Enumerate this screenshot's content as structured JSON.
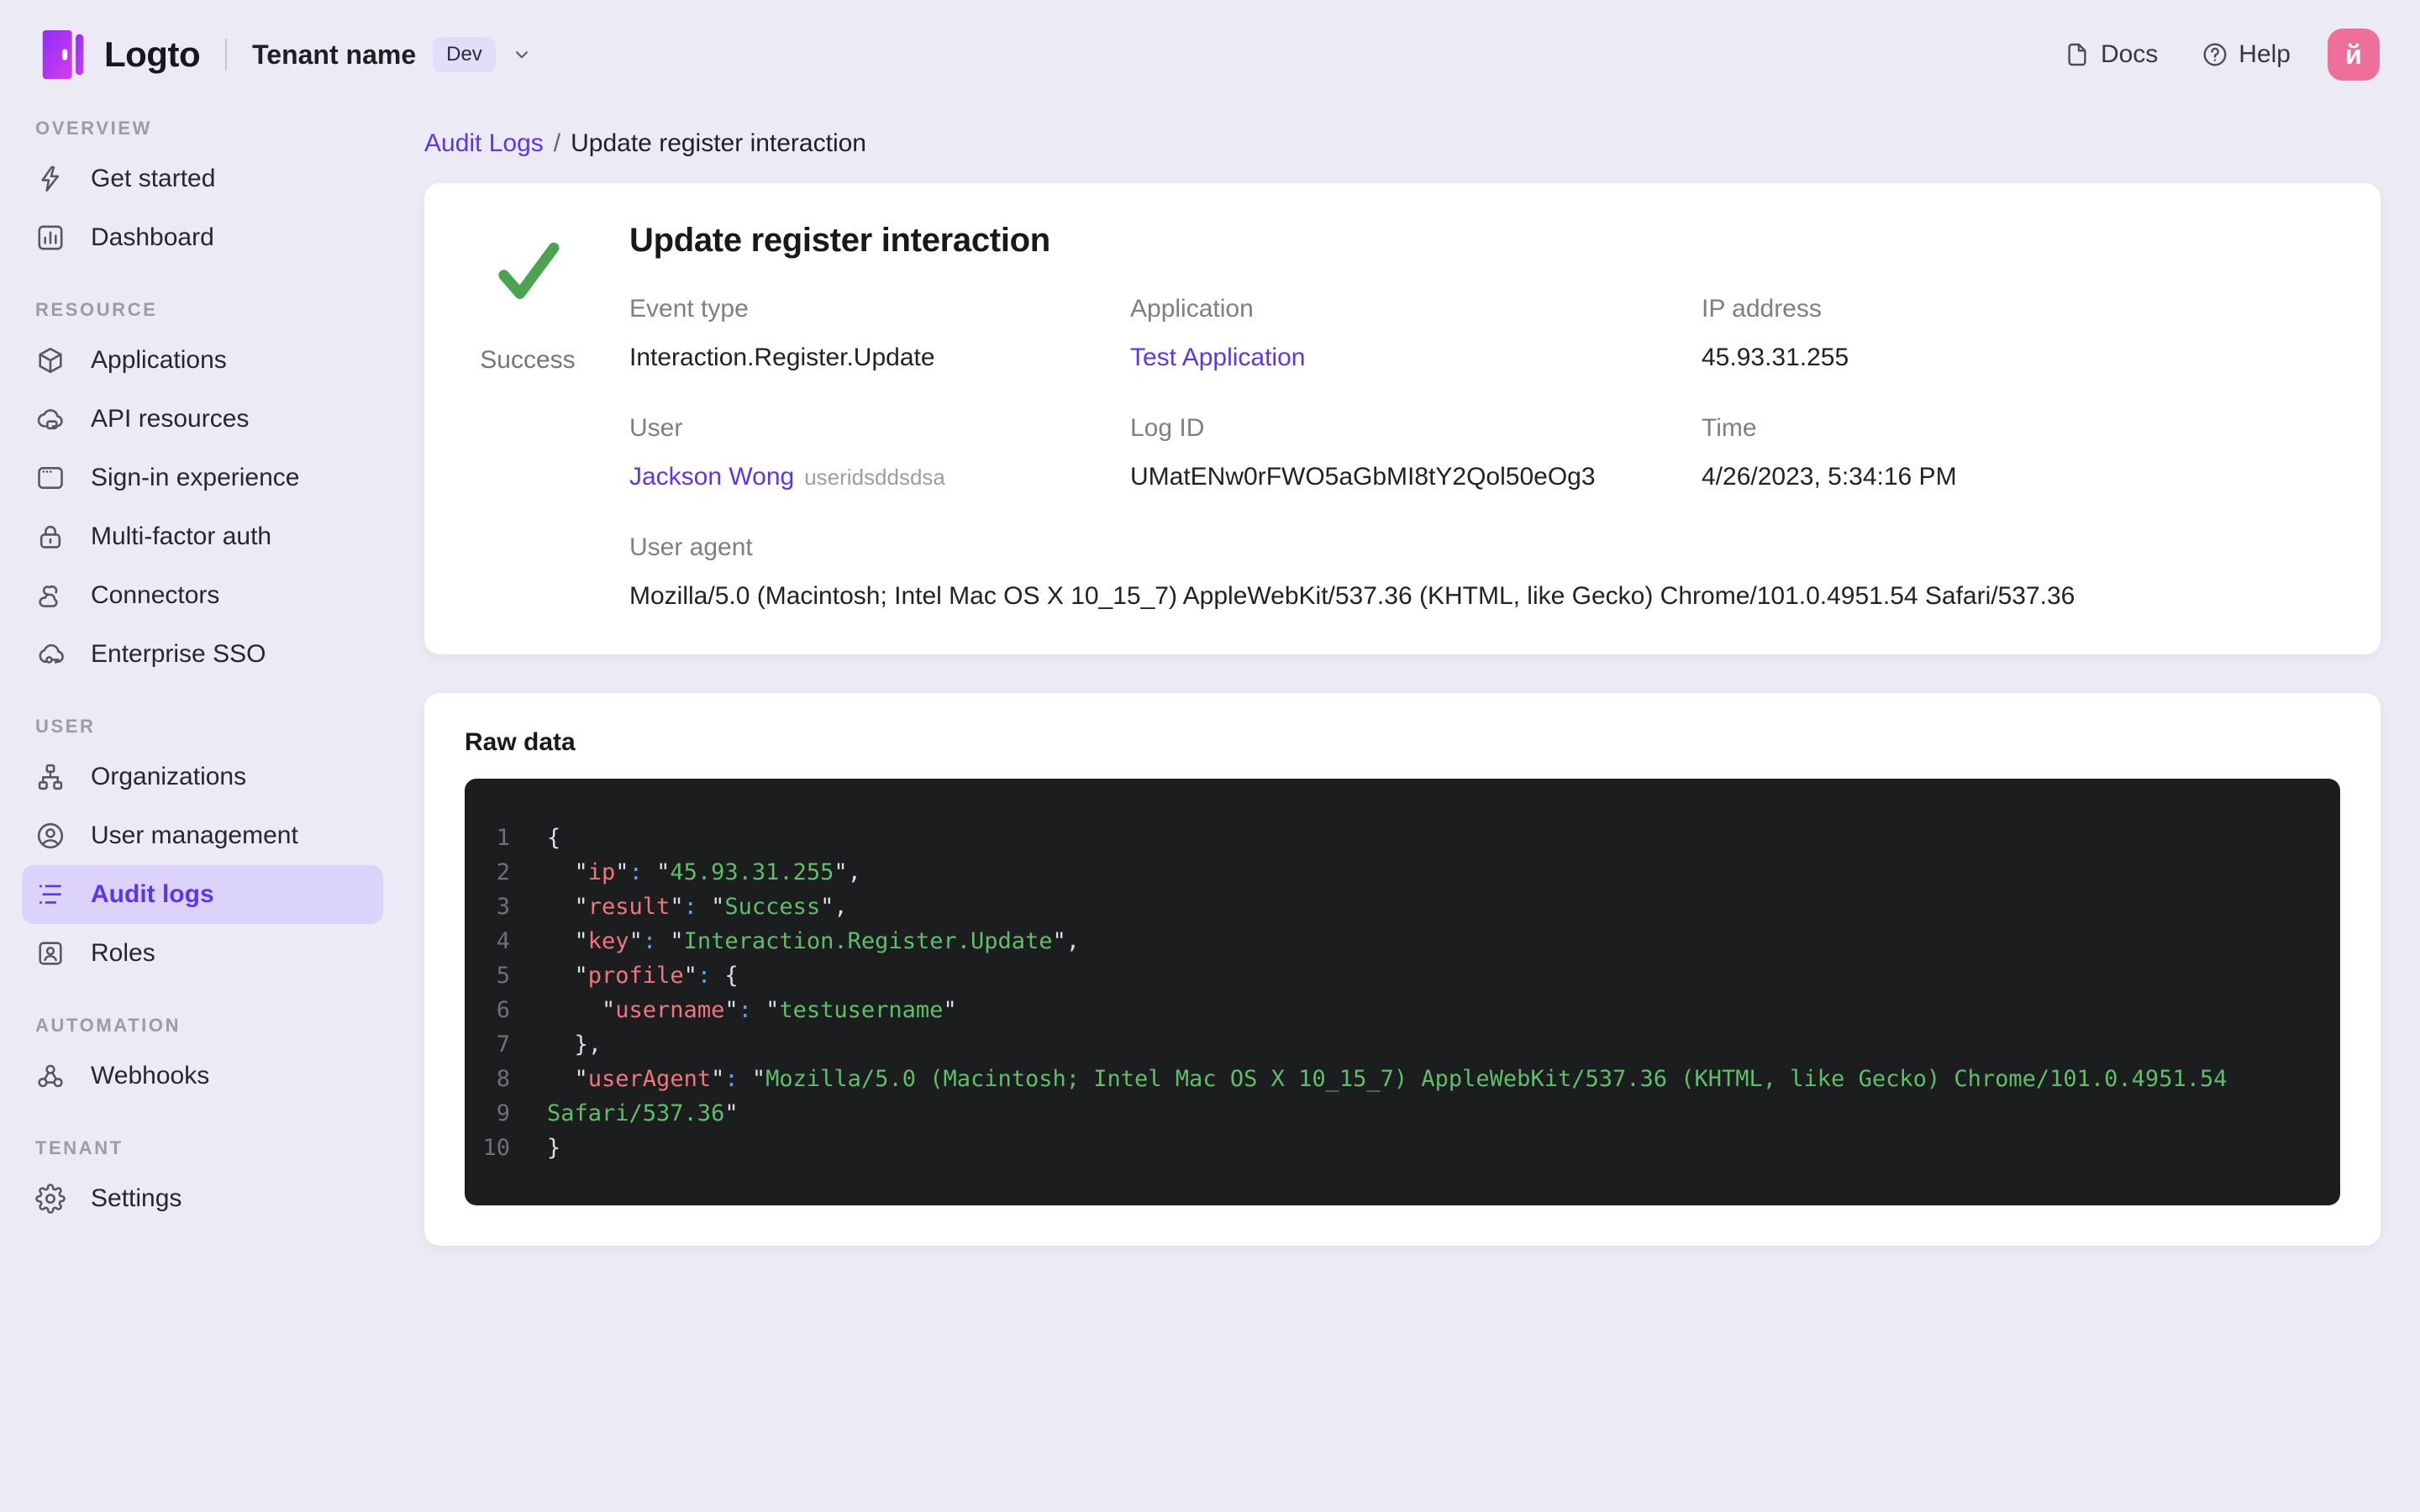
{
  "colors": {
    "accent": "#5d34f2",
    "accent_bg": "#dcd3fa",
    "page_bg": "#eceaf4",
    "card_bg": "#ffffff",
    "badge_bg": "#e3ddf9",
    "avatar_pink": "#ee6f9a",
    "success_green": "#4aa34f",
    "code_bg": "#1c1d1f",
    "code_text": "#dcdfe3",
    "code_line_number": "#6e7278",
    "code_key": "#f0767c",
    "code_colon": "#5ba3f0",
    "code_string": "#5fbf68"
  },
  "topbar": {
    "logo_text": "Logto",
    "tenant_name": "Tenant name",
    "env_badge": "Dev",
    "docs_label": "Docs",
    "help_label": "Help",
    "avatar_letter": "й"
  },
  "sidebar": {
    "sections": [
      {
        "label": "OVERVIEW",
        "items": [
          {
            "label": "Get started",
            "icon": "bolt"
          },
          {
            "label": "Dashboard",
            "icon": "dashboard"
          }
        ]
      },
      {
        "label": "RESOURCE",
        "items": [
          {
            "label": "Applications",
            "icon": "cube"
          },
          {
            "label": "API resources",
            "icon": "api"
          },
          {
            "label": "Sign-in experience",
            "icon": "browser"
          },
          {
            "label": "Multi-factor auth",
            "icon": "lock"
          },
          {
            "label": "Connectors",
            "icon": "connectors"
          },
          {
            "label": "Enterprise SSO",
            "icon": "sso"
          }
        ]
      },
      {
        "label": "USER",
        "items": [
          {
            "label": "Organizations",
            "icon": "org"
          },
          {
            "label": "User management",
            "icon": "user"
          },
          {
            "label": "Audit logs",
            "icon": "audit",
            "active": true
          },
          {
            "label": "Roles",
            "icon": "roles"
          }
        ]
      },
      {
        "label": "AUTOMATION",
        "items": [
          {
            "label": "Webhooks",
            "icon": "webhook"
          }
        ]
      },
      {
        "label": "TENANT",
        "items": [
          {
            "label": "Settings",
            "icon": "gear"
          }
        ]
      }
    ]
  },
  "breadcrumb": {
    "parent": "Audit Logs",
    "separator": "/",
    "current": "Update register interaction"
  },
  "detail": {
    "title": "Update register interaction",
    "status": "Success",
    "fields": [
      {
        "label": "Event type",
        "value": "Interaction.Register.Update"
      },
      {
        "label": "Application",
        "value": "Test Application",
        "link": true
      },
      {
        "label": "IP address",
        "value": "45.93.31.255"
      },
      {
        "label": "User",
        "value": "Jackson Wong",
        "link": true,
        "suffix": "useridsddsdsa"
      },
      {
        "label": "Log ID",
        "value": "UMatENw0rFWO5aGbMI8tY2Qol50eOg3"
      },
      {
        "label": "Time",
        "value": "4/26/2023, 5:34:16 PM"
      },
      {
        "label": "User agent",
        "value": "Mozilla/5.0 (Macintosh; Intel Mac OS X 10_15_7) AppleWebKit/537.36 (KHTML, like Gecko) Chrome/101.0.4951.54 Safari/537.36",
        "span": 3
      }
    ]
  },
  "raw": {
    "label": "Raw data",
    "lines": [
      {
        "n": "1",
        "tokens": [
          [
            "w",
            "{"
          ]
        ]
      },
      {
        "n": "2",
        "tokens": [
          [
            "w",
            "  \""
          ],
          [
            "k",
            "ip"
          ],
          [
            "w",
            "\""
          ],
          [
            "c",
            ":"
          ],
          [
            "w",
            " \""
          ],
          [
            "s",
            "45.93.31.255"
          ],
          [
            "w",
            "\","
          ]
        ]
      },
      {
        "n": "3",
        "tokens": [
          [
            "w",
            "  \""
          ],
          [
            "k",
            "result"
          ],
          [
            "w",
            "\""
          ],
          [
            "c",
            ":"
          ],
          [
            "w",
            " \""
          ],
          [
            "s",
            "Success"
          ],
          [
            "w",
            "\","
          ]
        ]
      },
      {
        "n": "4",
        "tokens": [
          [
            "w",
            "  \""
          ],
          [
            "k",
            "key"
          ],
          [
            "w",
            "\""
          ],
          [
            "c",
            ":"
          ],
          [
            "w",
            " \""
          ],
          [
            "s",
            "Interaction.Register.Update"
          ],
          [
            "w",
            "\","
          ]
        ]
      },
      {
        "n": "5",
        "tokens": [
          [
            "w",
            "  \""
          ],
          [
            "k",
            "profile"
          ],
          [
            "w",
            "\""
          ],
          [
            "c",
            ":"
          ],
          [
            "w",
            " {"
          ]
        ]
      },
      {
        "n": "6",
        "tokens": [
          [
            "w",
            "    \""
          ],
          [
            "k",
            "username"
          ],
          [
            "w",
            "\""
          ],
          [
            "c",
            ":"
          ],
          [
            "w",
            " \""
          ],
          [
            "s",
            "testusername"
          ],
          [
            "w",
            "\""
          ]
        ]
      },
      {
        "n": "7",
        "tokens": [
          [
            "w",
            "  },"
          ]
        ]
      },
      {
        "n": "8",
        "tokens": [
          [
            "w",
            "  \""
          ],
          [
            "k",
            "userAgent"
          ],
          [
            "w",
            "\""
          ],
          [
            "c",
            ":"
          ],
          [
            "w",
            " \""
          ],
          [
            "s",
            "Mozilla/5.0 (Macintosh; Intel Mac OS X 10_15_7) AppleWebKit/537.36 (KHTML, like Gecko) Chrome/101.0.4951.54"
          ]
        ]
      },
      {
        "n": "9",
        "tokens": [
          [
            "s",
            "Safari/537.36"
          ],
          [
            "w",
            "\""
          ]
        ]
      },
      {
        "n": "10",
        "tokens": [
          [
            "w",
            "}"
          ]
        ]
      }
    ]
  }
}
